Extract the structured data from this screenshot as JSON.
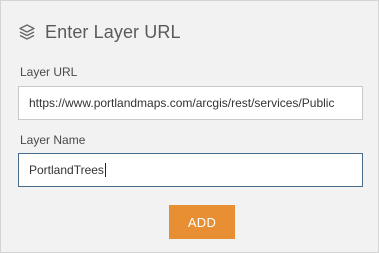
{
  "header": {
    "icon": "layers-icon",
    "title": "Enter Layer URL"
  },
  "form": {
    "layer_url": {
      "label": "Layer URL",
      "value": "https://www.portlandmaps.com/arcgis/rest/services/Public"
    },
    "layer_name": {
      "label": "Layer Name",
      "value": "PortlandTrees"
    },
    "add_label": "ADD"
  },
  "colors": {
    "panel_background": "#f2f2f2",
    "add_button": "#e88f33",
    "focused_border": "#4a6c8c"
  }
}
